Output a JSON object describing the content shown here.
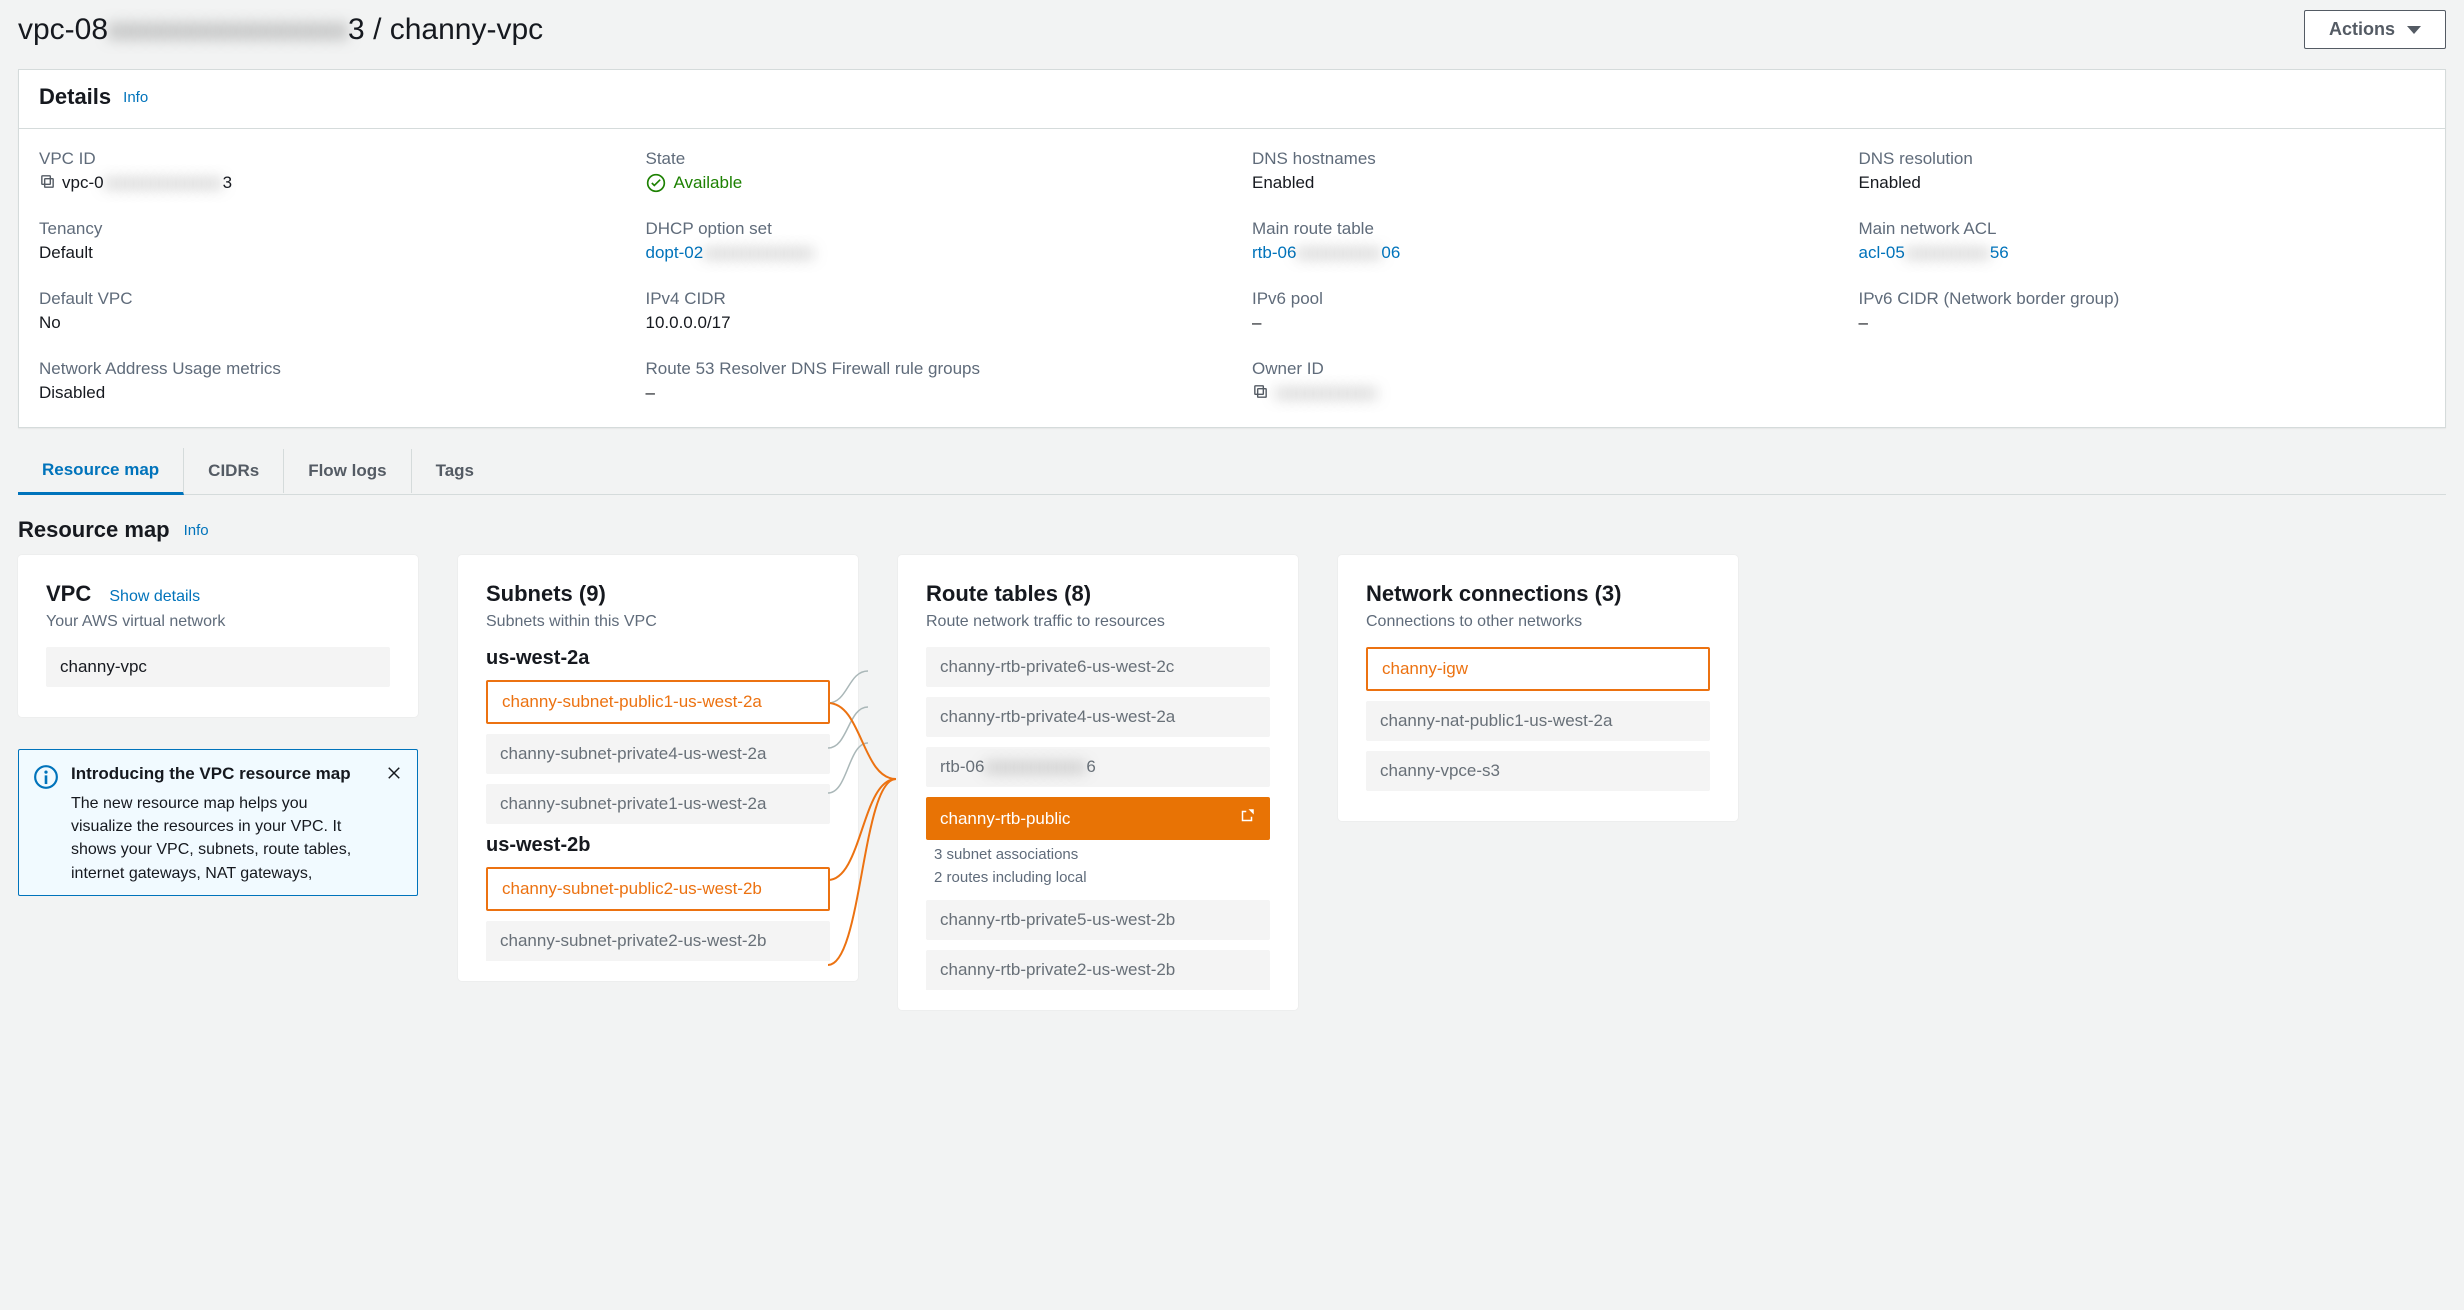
{
  "page": {
    "title_prefix": "vpc-08",
    "title_blur": "xxxxxxxxxxxxxxxx",
    "title_suffix": "3 / channy-vpc",
    "actions_label": "Actions"
  },
  "details": {
    "heading": "Details",
    "info": "Info",
    "rows": {
      "vpc_id_label": "VPC ID",
      "vpc_id_prefix": "vpc-0",
      "vpc_id_blur": "xxxxxxxxxxxxxx",
      "vpc_id_suffix": "3",
      "state_label": "State",
      "state_value": "Available",
      "dns_host_label": "DNS hostnames",
      "dns_host_value": "Enabled",
      "dns_res_label": "DNS resolution",
      "dns_res_value": "Enabled",
      "tenancy_label": "Tenancy",
      "tenancy_value": "Default",
      "dhcp_label": "DHCP option set",
      "dhcp_prefix": "dopt-02",
      "dhcp_blur": "xxxxxxxxxxxxx",
      "main_rt_label": "Main route table",
      "main_rt_prefix": "rtb-06",
      "main_rt_blur": "xxxxxxxxxx",
      "main_rt_suffix": "06",
      "main_acl_label": "Main network ACL",
      "main_acl_prefix": "acl-05",
      "main_acl_blur": "xxxxxxxxxx",
      "main_acl_suffix": "56",
      "default_vpc_label": "Default VPC",
      "default_vpc_value": "No",
      "ipv4_label": "IPv4 CIDR",
      "ipv4_value": "10.0.0.0/17",
      "ipv6pool_label": "IPv6 pool",
      "ipv6pool_value": "–",
      "ipv6cidr_label": "IPv6 CIDR (Network border group)",
      "ipv6cidr_value": "–",
      "naum_label": "Network Address Usage metrics",
      "naum_value": "Disabled",
      "r53_label": "Route 53 Resolver DNS Firewall rule groups",
      "r53_value": "–",
      "owner_label": "Owner ID",
      "owner_blur": "xxxxxxxxxxxx"
    }
  },
  "tabs": [
    "Resource map",
    "CIDRs",
    "Flow logs",
    "Tags"
  ],
  "resource_map": {
    "heading": "Resource map",
    "info": "Info",
    "vpc": {
      "title": "VPC",
      "show_details": "Show details",
      "sub": "Your AWS virtual network",
      "item": "channy-vpc"
    },
    "subnets": {
      "title": "Subnets (9)",
      "sub": "Subnets within this VPC",
      "az1": "us-west-2a",
      "az1_items": [
        {
          "name": "channy-subnet-public1-us-west-2a",
          "hl": true
        },
        {
          "name": "channy-subnet-private4-us-west-2a",
          "hl": false
        },
        {
          "name": "channy-subnet-private1-us-west-2a",
          "hl": false
        }
      ],
      "az2": "us-west-2b",
      "az2_items": [
        {
          "name": "channy-subnet-public2-us-west-2b",
          "hl": true
        },
        {
          "name": "channy-subnet-private2-us-west-2b",
          "hl": false
        }
      ]
    },
    "route_tables": {
      "title": "Route tables (8)",
      "sub": "Route network traffic to resources",
      "items": [
        {
          "name": "channy-rtb-private6-us-west-2c"
        },
        {
          "name": "channy-rtb-private4-us-west-2a"
        },
        {
          "prefix": "rtb-06",
          "blur": "xxxxxxxxxxxx",
          "suffix": "6"
        },
        {
          "name": "channy-rtb-public",
          "selected": true,
          "meta1": "3 subnet associations",
          "meta2": "2 routes including local"
        },
        {
          "name": "channy-rtb-private5-us-west-2b"
        },
        {
          "name": "channy-rtb-private2-us-west-2b",
          "partial": true
        }
      ]
    },
    "network_connections": {
      "title": "Network connections (3)",
      "sub": "Connections to other networks",
      "items": [
        {
          "name": "channy-igw",
          "hl": true
        },
        {
          "name": "channy-nat-public1-us-west-2a"
        },
        {
          "name": "channy-vpce-s3"
        }
      ]
    }
  },
  "info_box": {
    "title": "Introducing the VPC resource map",
    "body": "The new resource map helps you visualize the resources in your VPC. It shows your VPC, subnets, route tables, internet gateways, NAT gateways,"
  }
}
